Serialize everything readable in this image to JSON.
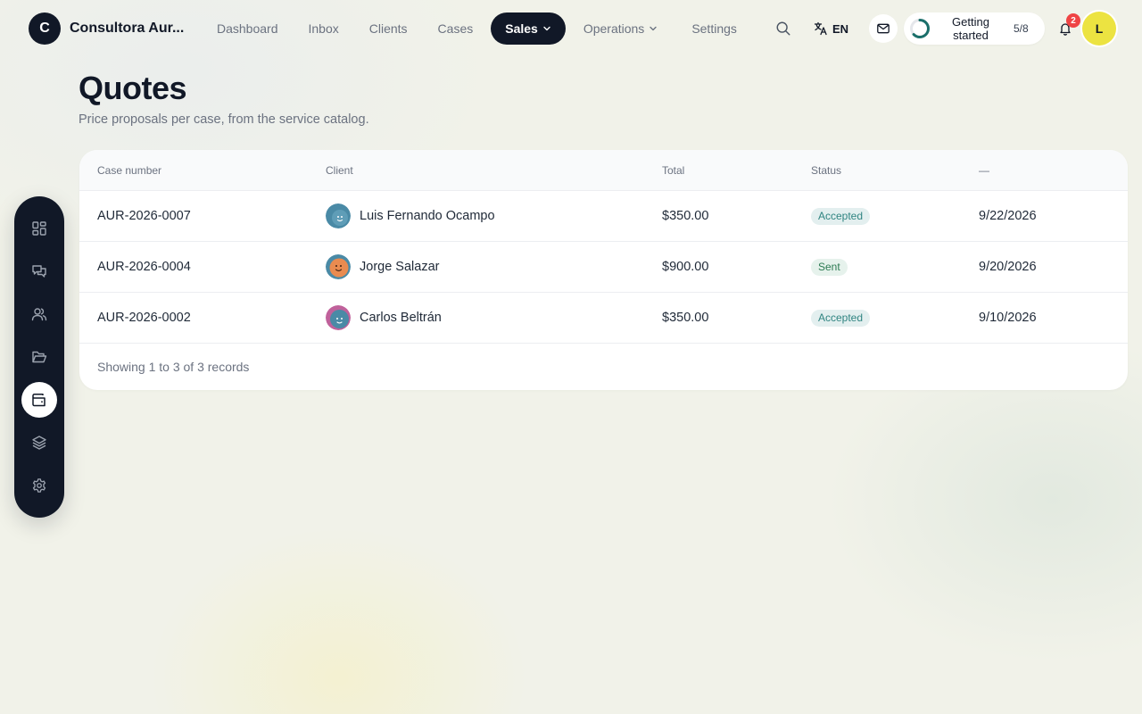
{
  "brand": {
    "initial": "C",
    "name": "Consultora Aur..."
  },
  "nav": {
    "items": [
      {
        "label": "Dashboard"
      },
      {
        "label": "Inbox"
      },
      {
        "label": "Clients"
      },
      {
        "label": "Cases"
      },
      {
        "label": "Sales",
        "active": true,
        "has_dropdown": true
      },
      {
        "label": "Operations",
        "has_dropdown": true
      },
      {
        "label": "Settings"
      }
    ]
  },
  "toolbar": {
    "search_icon": "search-icon",
    "language": "EN",
    "mail_icon": "mail-icon",
    "onboarding": {
      "label": "Getting started",
      "progress": "5/8",
      "progress_fraction": 0.625
    },
    "notifications": {
      "count": "2"
    },
    "user_initial": "L"
  },
  "rail": {
    "items": [
      {
        "icon": "dashboard-icon"
      },
      {
        "icon": "chat-icon"
      },
      {
        "icon": "users-icon"
      },
      {
        "icon": "folder-icon"
      },
      {
        "icon": "wallet-icon",
        "active": true
      },
      {
        "icon": "layers-icon"
      },
      {
        "icon": "gear-icon"
      }
    ]
  },
  "page": {
    "title": "Quotes",
    "subtitle": "Price proposals per case, from the service catalog."
  },
  "table": {
    "columns": [
      "Case number",
      "Client",
      "Total",
      "Status",
      "—"
    ],
    "rows": [
      {
        "case_number": "AUR-2026-0007",
        "client": "Luis Fernando Ocampo",
        "total": "$350.00",
        "status": "Accepted",
        "date": "9/22/2026"
      },
      {
        "case_number": "AUR-2026-0004",
        "client": "Jorge Salazar",
        "total": "$900.00",
        "status": "Sent",
        "date": "9/20/2026"
      },
      {
        "case_number": "AUR-2026-0002",
        "client": "Carlos Beltrán",
        "total": "$350.00",
        "status": "Accepted",
        "date": "9/10/2026"
      }
    ],
    "footer": "Showing 1 to 3 of 3 records"
  },
  "colors": {
    "ink": "#111827",
    "accepted_badge": "#2f8481",
    "sent_badge": "#2c7a52",
    "notification_badge": "#ef4444",
    "user_avatar": "#ece341",
    "progress_ring": "#1b6f6a"
  }
}
